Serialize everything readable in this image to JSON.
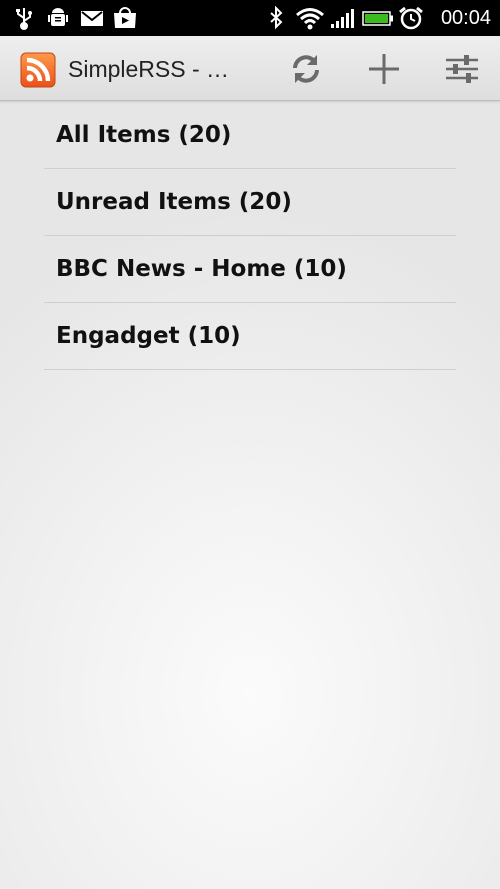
{
  "status_bar": {
    "time": "00:04",
    "icons": [
      "usb-icon",
      "android-debug-icon",
      "gmail-icon",
      "play-store-icon",
      "bluetooth-icon",
      "wifi-icon",
      "signal-icon",
      "battery-icon",
      "alarm-icon"
    ],
    "battery_color": "#3cbc1c"
  },
  "action_bar": {
    "app_icon": "rss-icon",
    "title": "SimpleRSS - …",
    "actions": [
      "refresh-icon",
      "add-icon",
      "settings-sliders-icon"
    ],
    "rss_color": "#f26522"
  },
  "feeds": [
    {
      "label": "All Items (20)"
    },
    {
      "label": "Unread Items (20)"
    },
    {
      "label": "BBC News - Home (10)"
    },
    {
      "label": "Engadget (10)"
    }
  ]
}
